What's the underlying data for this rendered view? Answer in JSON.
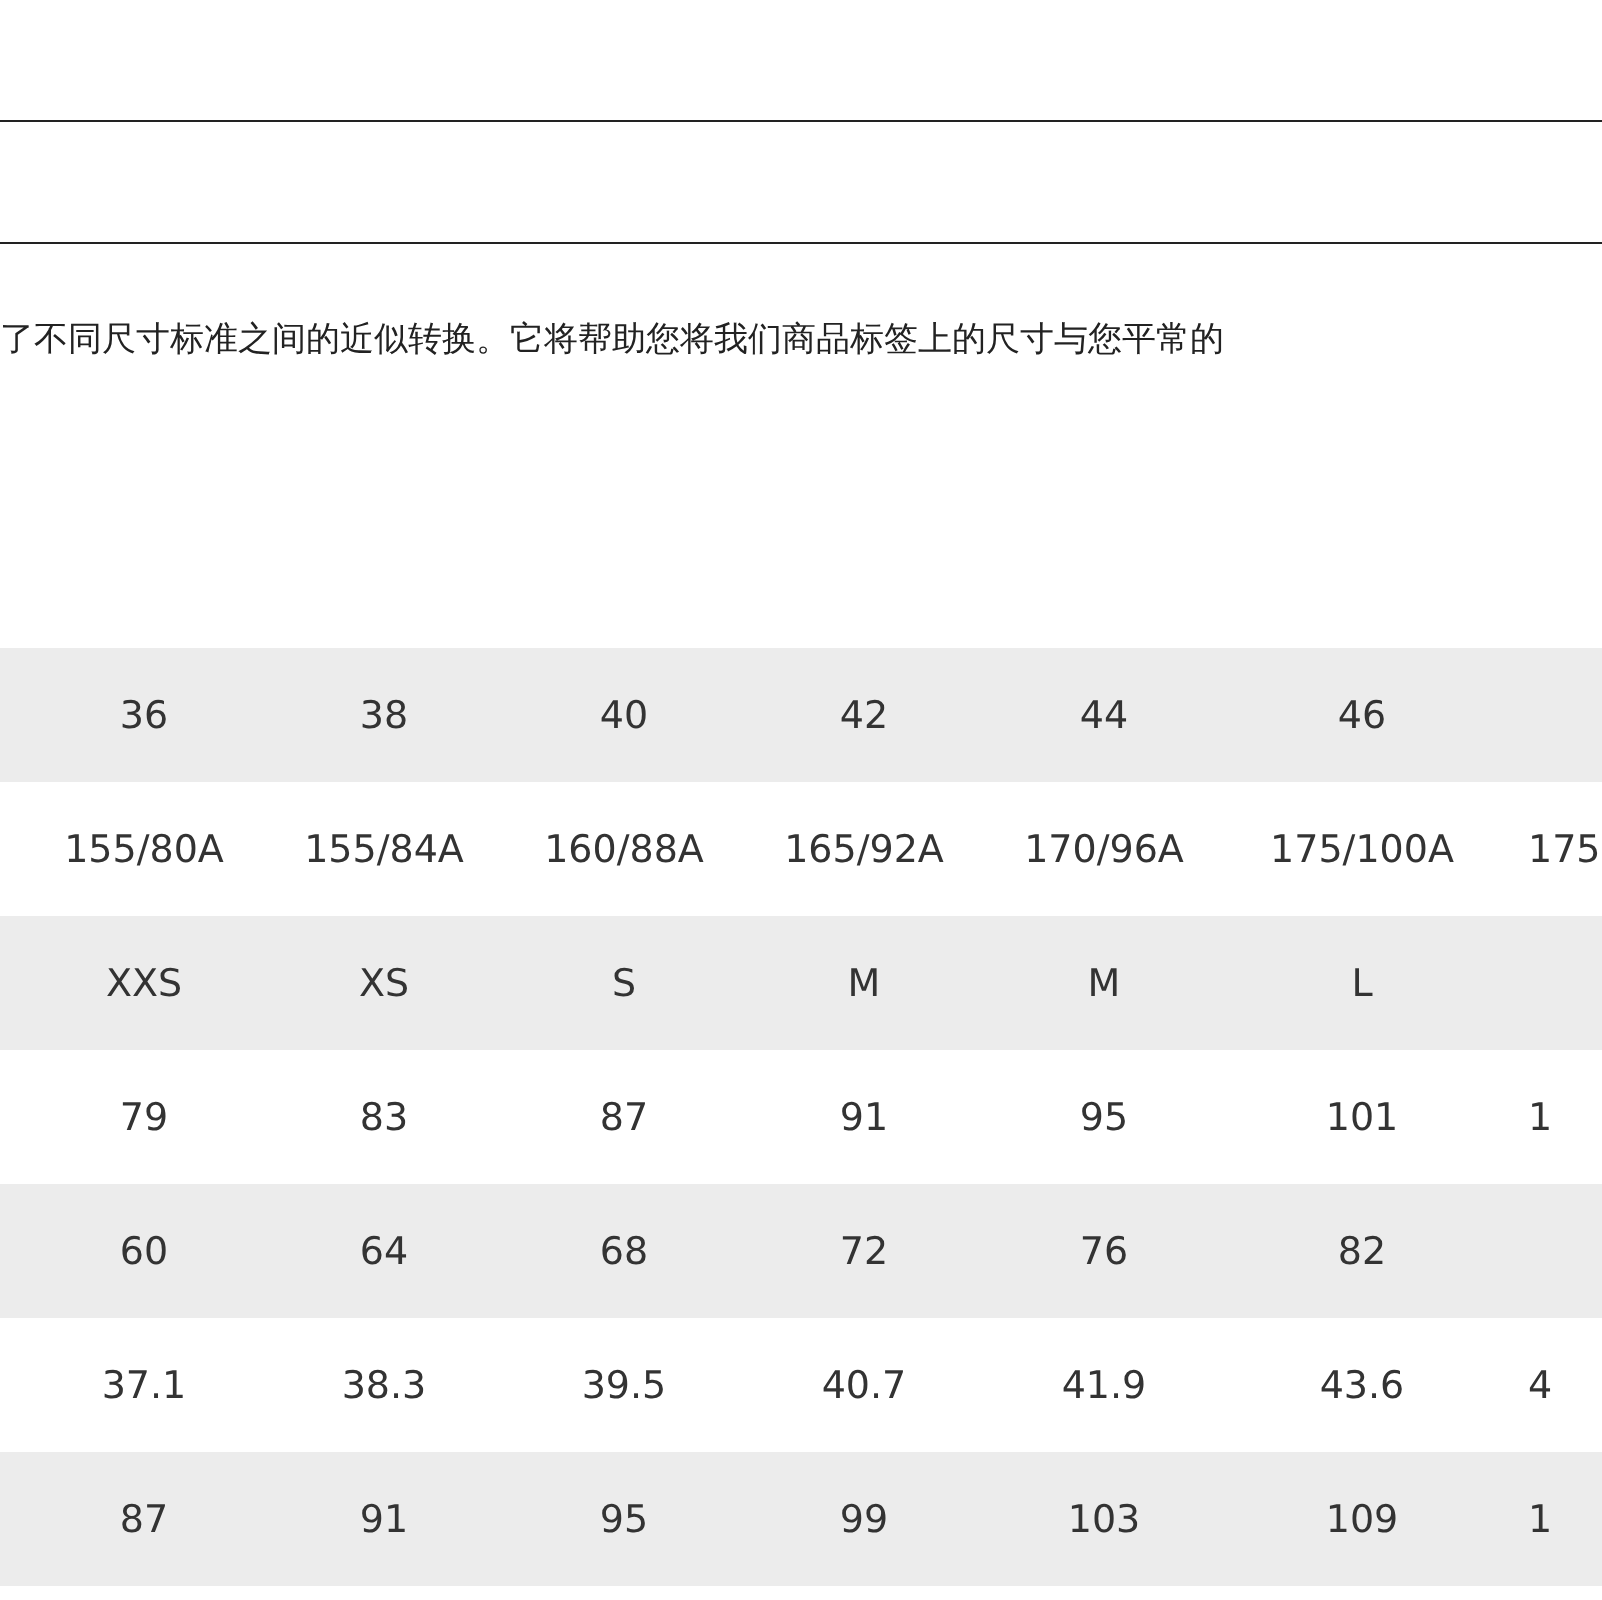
{
  "intro": "了不同尺寸标准之间的近似转换。它将帮助您将我们商品标签上的尺寸与您平常的",
  "table": {
    "rows": [
      {
        "cells": [
          "36",
          "38",
          "40",
          "42",
          "44",
          "46",
          ""
        ]
      },
      {
        "cells": [
          "155/80A",
          "155/84A",
          "160/88A",
          "165/92A",
          "170/96A",
          "175/100A",
          "175"
        ]
      },
      {
        "cells": [
          "XXS",
          "XS",
          "S",
          "M",
          "M",
          "L",
          ""
        ]
      },
      {
        "cells": [
          "79",
          "83",
          "87",
          "91",
          "95",
          "101",
          "1"
        ]
      },
      {
        "cells": [
          "60",
          "64",
          "68",
          "72",
          "76",
          "82",
          ""
        ]
      },
      {
        "cells": [
          "37.1",
          "38.3",
          "39.5",
          "40.7",
          "41.9",
          "43.6",
          "4"
        ]
      },
      {
        "cells": [
          "87",
          "91",
          "95",
          "99",
          "103",
          "109",
          "1"
        ]
      }
    ]
  }
}
